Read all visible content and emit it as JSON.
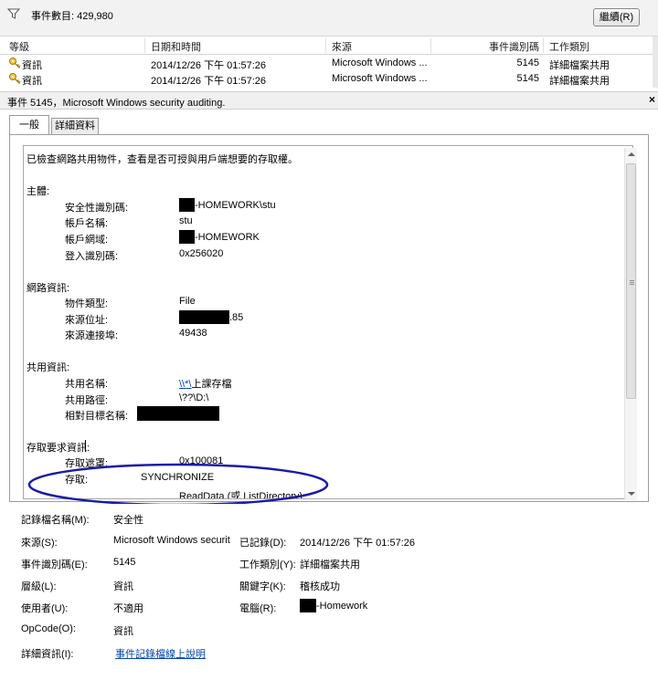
{
  "filter_bar": {
    "event_count": "事件數目: 429,980",
    "clear_button": "繼續(R)"
  },
  "grid": {
    "columns": [
      "等級",
      "日期和時間",
      "來源",
      "事件識別碼",
      "工作類別"
    ],
    "rows": [
      {
        "level": "資訊",
        "datetime": "2014/12/26 下午 01:57:26",
        "source": "Microsoft Windows ...",
        "event_id": "5145",
        "task_category": "詳細檔案共用"
      },
      {
        "level": "資訊",
        "datetime": "2014/12/26 下午 01:57:26",
        "source": "Microsoft Windows ...",
        "event_id": "5145",
        "task_category": "詳細檔案共用"
      }
    ]
  },
  "detail": {
    "title": "事件 5145，Microsoft Windows security auditing.",
    "close_glyph": "×",
    "tabs": [
      "一般",
      "詳細資料"
    ]
  },
  "description": {
    "intro": "已檢查網路共用物件，查看是否可授與用戶端想要的存取權。",
    "subject": {
      "header": "主體:",
      "security_id_label": "安全性識別碼:",
      "security_id_value": "-HOMEWORK\\stu",
      "account_name_label": "帳戶名稱:",
      "account_name_value": "stu",
      "account_domain_label": "帳戶網域:",
      "account_domain_value": "-HOMEWORK",
      "logon_id_label": "登入識別碼:",
      "logon_id_value": "0x256020"
    },
    "network": {
      "header": "網路資訊:",
      "object_type_label": "物件類型:",
      "object_type_value": "File",
      "source_address_label": "來源位址:",
      "source_address_value": ".85",
      "source_port_label": "來源連接埠:",
      "source_port_value": "49438"
    },
    "share": {
      "header": "共用資訊:",
      "share_name_label": "共用名稱:",
      "share_name_link": "\\\\*\\",
      "share_name_rest": "上課存檔",
      "share_path_label": "共用路徑:",
      "share_path_value": "\\??\\D:\\",
      "relative_target_label": "相對目標名稱:"
    },
    "access": {
      "header": "存取要求資訊:",
      "access_mask_label": "存取遮罩:",
      "access_mask_value": "0x100081",
      "accesses_label": "存取:",
      "accesses_value_1": "SYNCHRONIZE",
      "accesses_value_2": "ReadData (或 ListDirectory)"
    }
  },
  "properties": {
    "log_name_label": "記錄檔名稱(M):",
    "log_name_value": "安全性",
    "source_label": "來源(S):",
    "source_value": "Microsoft Windows securit",
    "logged_label": "已記錄(D):",
    "logged_value": "2014/12/26 下午 01:57:26",
    "event_id_label": "事件識別碼(E):",
    "event_id_value": "5145",
    "task_category_label": "工作類別(Y):",
    "task_category_value": "詳細檔案共用",
    "level_label": "層級(L):",
    "level_value": "資訊",
    "keywords_label": "關鍵字(K):",
    "keywords_value": "稽核成功",
    "user_label": "使用者(U):",
    "user_value": "不適用",
    "computer_label": "電腦(R):",
    "computer_value": "-Homework",
    "opcode_label": "OpCode(O):",
    "opcode_value": "資訊",
    "more_info_label": "詳細資訊(I):",
    "more_info_link": "事件記錄檔線上說明"
  },
  "colors": {
    "annotation_ellipse": "#1a1aa8",
    "link": "#0645ad"
  },
  "icons": [
    "filter-icon",
    "key-icon",
    "close-icon"
  ]
}
